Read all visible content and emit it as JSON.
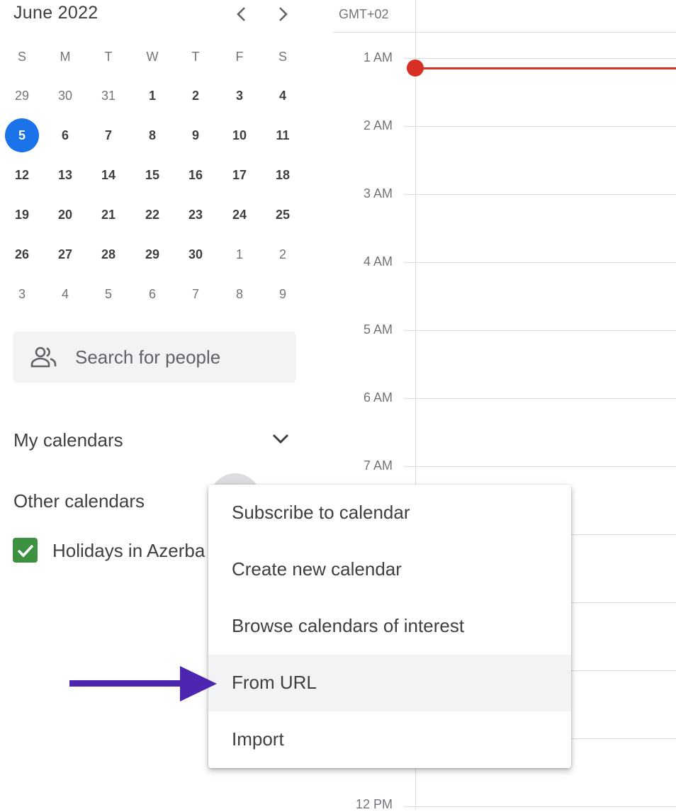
{
  "mini_calendar": {
    "month_label": "June 2022",
    "weekdays": [
      "S",
      "M",
      "T",
      "W",
      "T",
      "F",
      "S"
    ],
    "weeks": [
      [
        "29",
        "30",
        "31",
        "1",
        "2",
        "3",
        "4"
      ],
      [
        "5",
        "6",
        "7",
        "8",
        "9",
        "10",
        "11"
      ],
      [
        "12",
        "13",
        "14",
        "15",
        "16",
        "17",
        "18"
      ],
      [
        "19",
        "20",
        "21",
        "22",
        "23",
        "24",
        "25"
      ],
      [
        "26",
        "27",
        "28",
        "29",
        "30",
        "1",
        "2"
      ],
      [
        "3",
        "4",
        "5",
        "6",
        "7",
        "8",
        "9"
      ]
    ],
    "today": "5"
  },
  "search": {
    "placeholder": "Search for people"
  },
  "sections": {
    "my_calendars": "My calendars",
    "other_calendars": "Other calendars"
  },
  "other_calendars_items": [
    {
      "label": "Holidays in Azerba",
      "checked": true,
      "color": "#3f9142"
    }
  ],
  "day_view": {
    "timezone": "GMT+02",
    "hours": [
      "1 AM",
      "2 AM",
      "3 AM",
      "4 AM",
      "5 AM",
      "6 AM",
      "7 AM",
      "12 PM"
    ],
    "now_indicator_color": "#d93025"
  },
  "menu": {
    "items": [
      "Subscribe to calendar",
      "Create new calendar",
      "Browse calendars of interest",
      "From URL",
      "Import"
    ],
    "highlighted": "From URL"
  },
  "colors": {
    "accent": "#1a73e8",
    "arrow": "#4c25b0"
  }
}
